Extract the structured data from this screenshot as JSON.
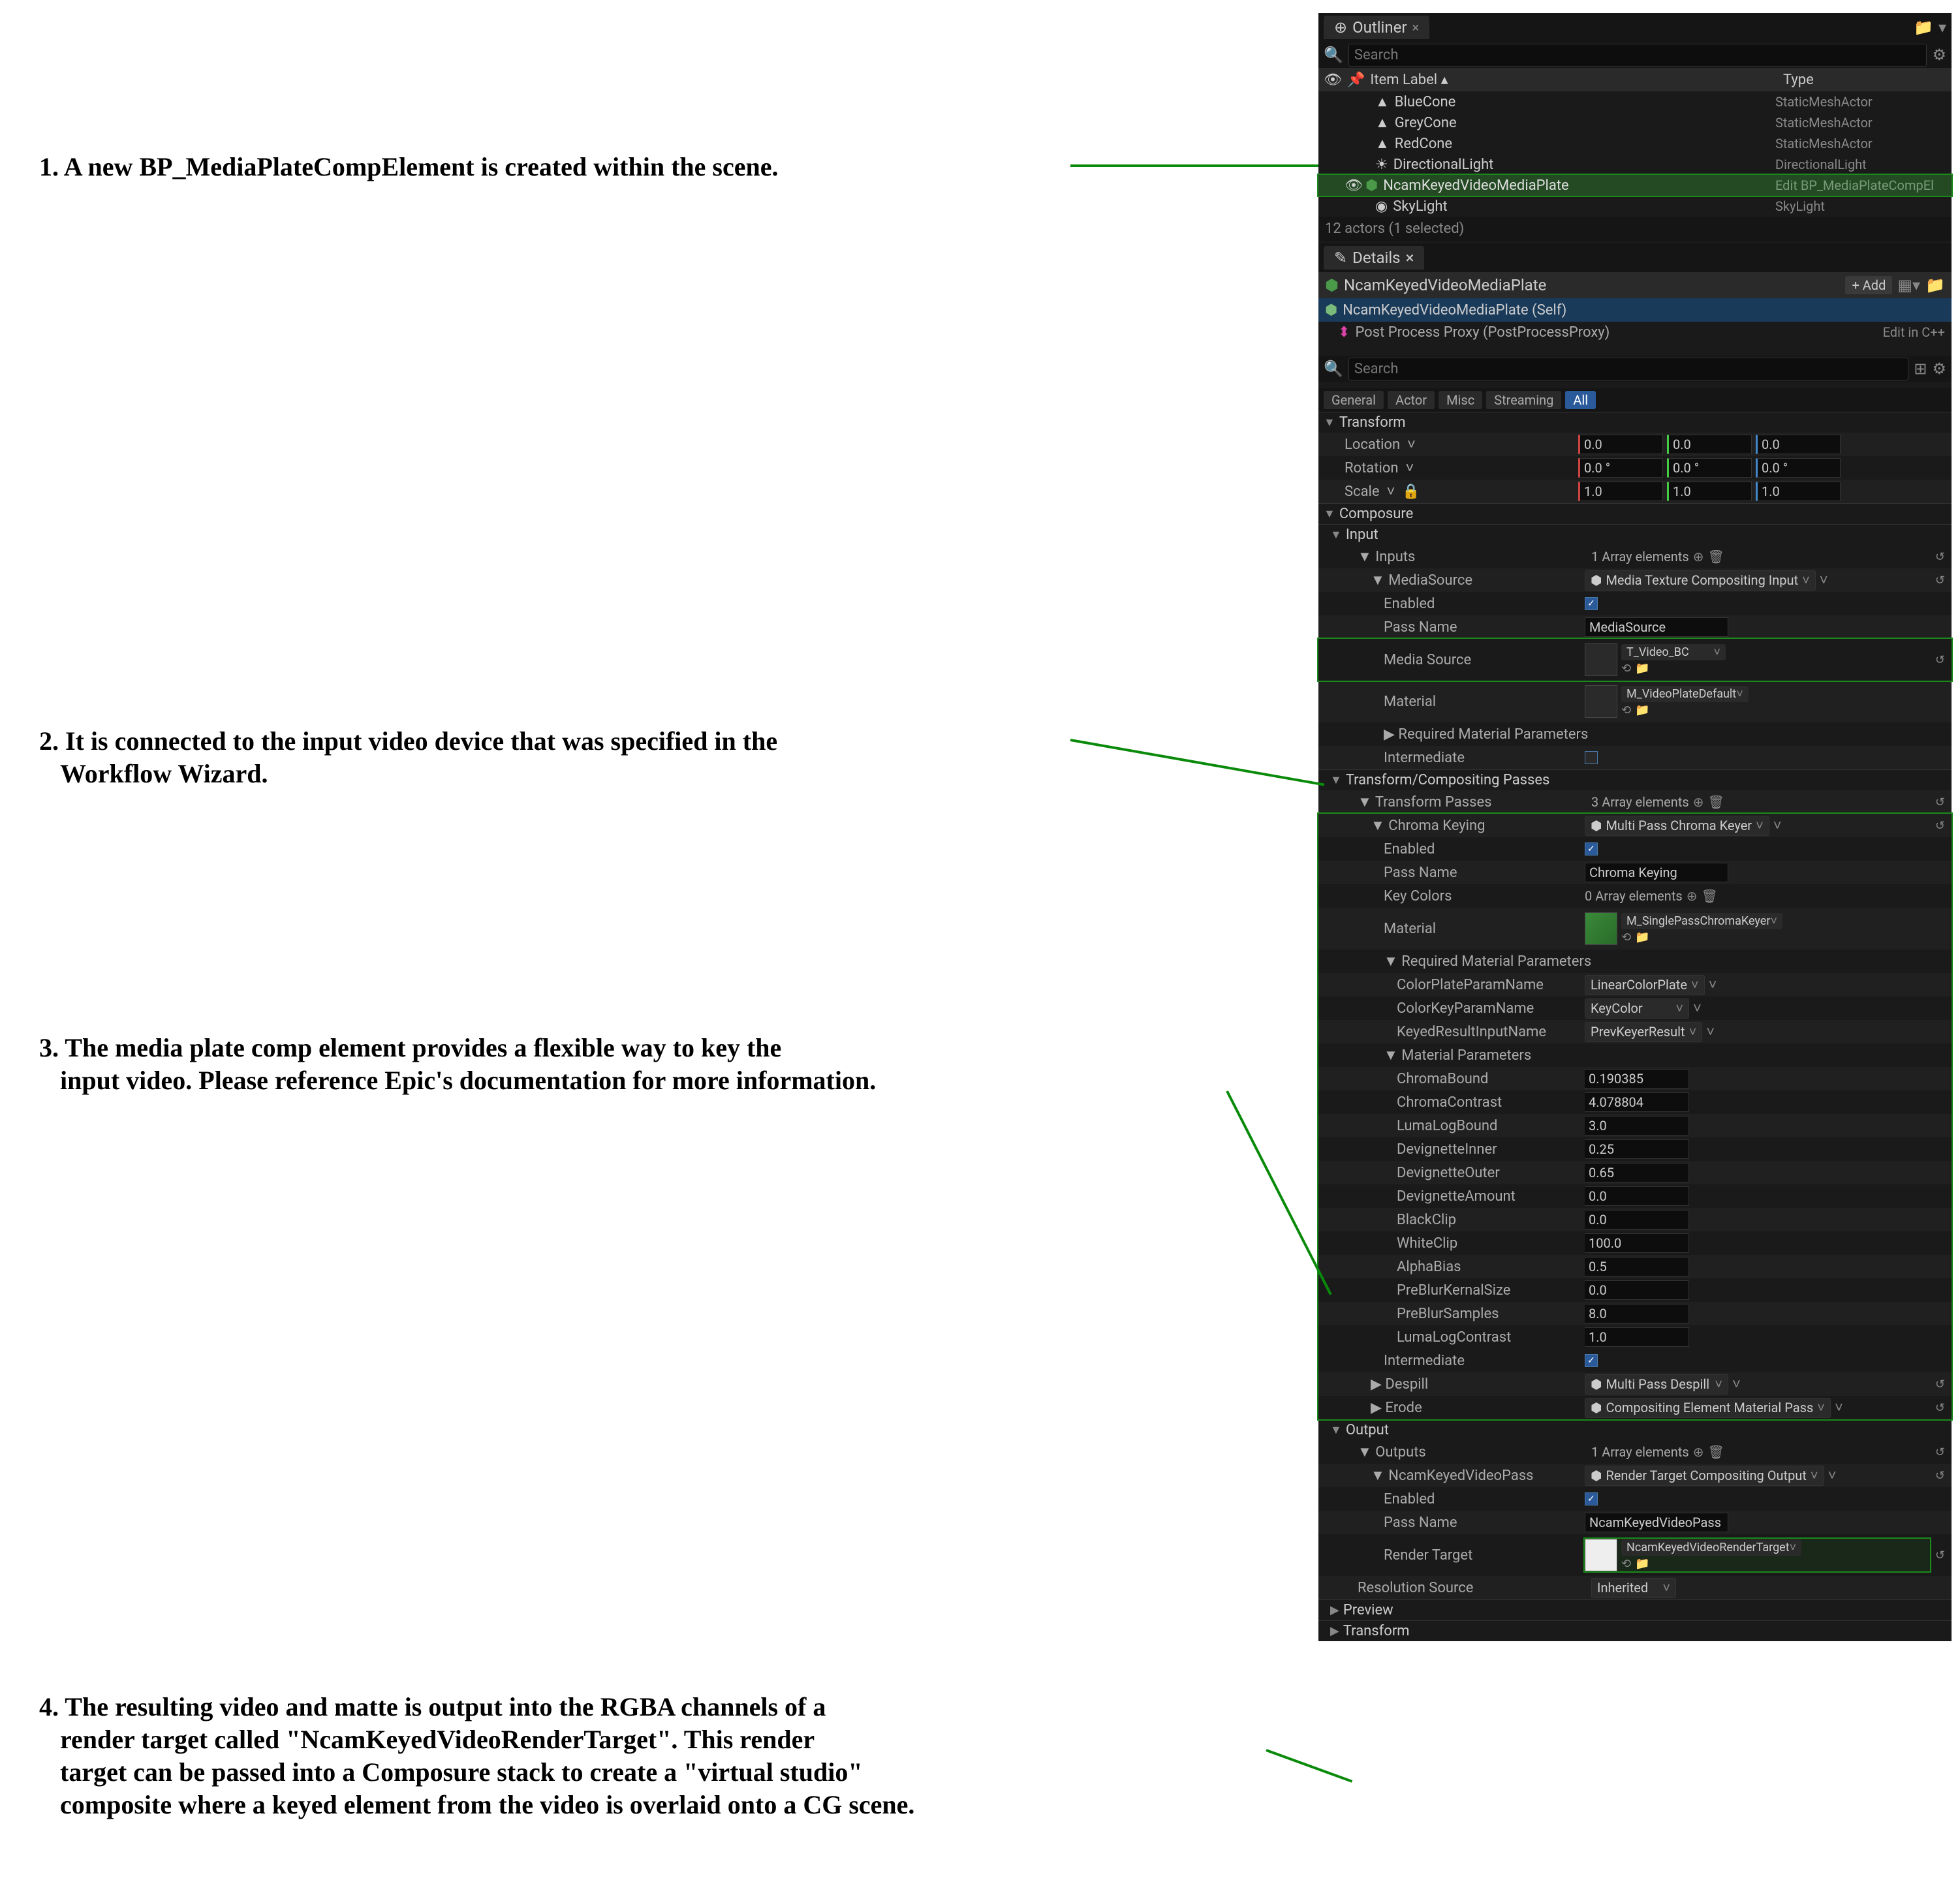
{
  "annotations": {
    "a1": "1. A new BP_MediaPlateCompElement is created within the scene.",
    "a2a": "2. It is connected to the input video device that was specified in the",
    "a2b": "Workflow Wizard.",
    "a3a": "3. The media plate comp element provides a flexible way to key the",
    "a3b": "input video. Please reference Epic's documentation for more information.",
    "a4a": "4. The resulting video and matte is output into the RGBA channels of a",
    "a4b": "render target called \"NcamKeyedVideoRenderTarget\". This render",
    "a4c": "target can be passed into a Composure stack to create a \"virtual studio\"",
    "a4d": "composite where a keyed element from the video is overlaid onto a CG scene."
  },
  "outliner": {
    "title": "Outliner",
    "search_ph": "Search",
    "col_label": "Item Label",
    "col_type": "Type",
    "rows": [
      {
        "name": "BlueCone",
        "type": "StaticMeshActor"
      },
      {
        "name": "GreyCone",
        "type": "StaticMeshActor"
      },
      {
        "name": "RedCone",
        "type": "StaticMeshActor"
      },
      {
        "name": "DirectionalLight",
        "type": "DirectionalLight"
      },
      {
        "name": "NcamKeyedVideoMediaPlate",
        "type": "Edit BP_MediaPlateCompEl"
      },
      {
        "name": "SkyLight",
        "type": "SkyLight"
      }
    ],
    "footer": "12 actors (1 selected)"
  },
  "details": {
    "title": "Details",
    "actor_name": "NcamKeyedVideoMediaPlate",
    "add_label": "+ Add",
    "self_row": "NcamKeyedVideoMediaPlate (Self)",
    "proxy_row": "Post Process Proxy (PostProcessProxy)",
    "edit_cpp": "Edit in C++",
    "search_ph": "Search",
    "filters": [
      "General",
      "Actor",
      "Misc",
      "Streaming",
      "All"
    ]
  },
  "transform": {
    "header": "Transform",
    "location": "Location",
    "rotation": "Rotation",
    "scale": "Scale",
    "loc_vals": [
      "0.0",
      "0.0",
      "0.0"
    ],
    "rot_vals": [
      "0.0 °",
      "0.0 °",
      "0.0 °"
    ],
    "scale_vals": [
      "1.0",
      "1.0",
      "1.0"
    ]
  },
  "composure": {
    "header": "Composure",
    "input": {
      "header": "Input",
      "inputs_label": "Inputs",
      "inputs_count": "1 Array elements",
      "mediasource_label": "MediaSource",
      "mediasource_type": "Media Texture Compositing Input",
      "enabled_label": "Enabled",
      "passname_label": "Pass Name",
      "passname_value": "MediaSource",
      "media_source_label": "Media Source",
      "media_source_value": "T_Video_BC",
      "material_label": "Material",
      "material_value": "M_VideoPlateDefault",
      "req_params": "Required Material Parameters",
      "intermediate": "Intermediate"
    },
    "tcp": {
      "header": "Transform/Compositing Passes",
      "passes_label": "Transform Passes",
      "passes_count": "3 Array elements",
      "chroma": {
        "label": "Chroma Keying",
        "type": "Multi Pass Chroma Keyer",
        "enabled": "Enabled",
        "passname": "Pass Name",
        "passname_val": "Chroma Keying",
        "keycolors": "Key Colors",
        "keycolors_count": "0 Array elements",
        "material": "Material",
        "material_val": "M_SinglePassChromaKeyer",
        "req": "Required Material Parameters",
        "req_rows": [
          {
            "k": "ColorPlateParamName",
            "v": "LinearColorPlate"
          },
          {
            "k": "ColorKeyParamName",
            "v": "KeyColor"
          },
          {
            "k": "KeyedResultInputName",
            "v": "PrevKeyerResult"
          }
        ],
        "matparams": "Material Parameters",
        "params": [
          {
            "k": "ChromaBound",
            "v": "0.190385"
          },
          {
            "k": "ChromaContrast",
            "v": "4.078804"
          },
          {
            "k": "LumaLogBound",
            "v": "3.0"
          },
          {
            "k": "DevignetteInner",
            "v": "0.25"
          },
          {
            "k": "DevignetteOuter",
            "v": "0.65"
          },
          {
            "k": "DevignetteAmount",
            "v": "0.0"
          },
          {
            "k": "BlackClip",
            "v": "0.0"
          },
          {
            "k": "WhiteClip",
            "v": "100.0"
          },
          {
            "k": "AlphaBias",
            "v": "0.5"
          },
          {
            "k": "PreBlurKernalSize",
            "v": "0.0"
          },
          {
            "k": "PreBlurSamples",
            "v": "8.0"
          },
          {
            "k": "LumaLogContrast",
            "v": "1.0"
          }
        ],
        "intermediate": "Intermediate"
      },
      "despill": {
        "label": "Despill",
        "type": "Multi Pass Despill"
      },
      "erode": {
        "label": "Erode",
        "type": "Compositing Element Material Pass"
      }
    },
    "output": {
      "header": "Output",
      "outputs_label": "Outputs",
      "outputs_count": "1 Array elements",
      "pass": {
        "label": "NcamKeyedVideoPass",
        "type": "Render Target Compositing Output",
        "enabled": "Enabled",
        "passname": "Pass Name",
        "passname_val": "NcamKeyedVideoPass",
        "rt_label": "Render Target",
        "rt_value": "NcamKeyedVideoRenderTarget"
      },
      "res_src": "Resolution Source",
      "res_val": "Inherited"
    },
    "preview": "Preview",
    "transform": "Transform"
  }
}
